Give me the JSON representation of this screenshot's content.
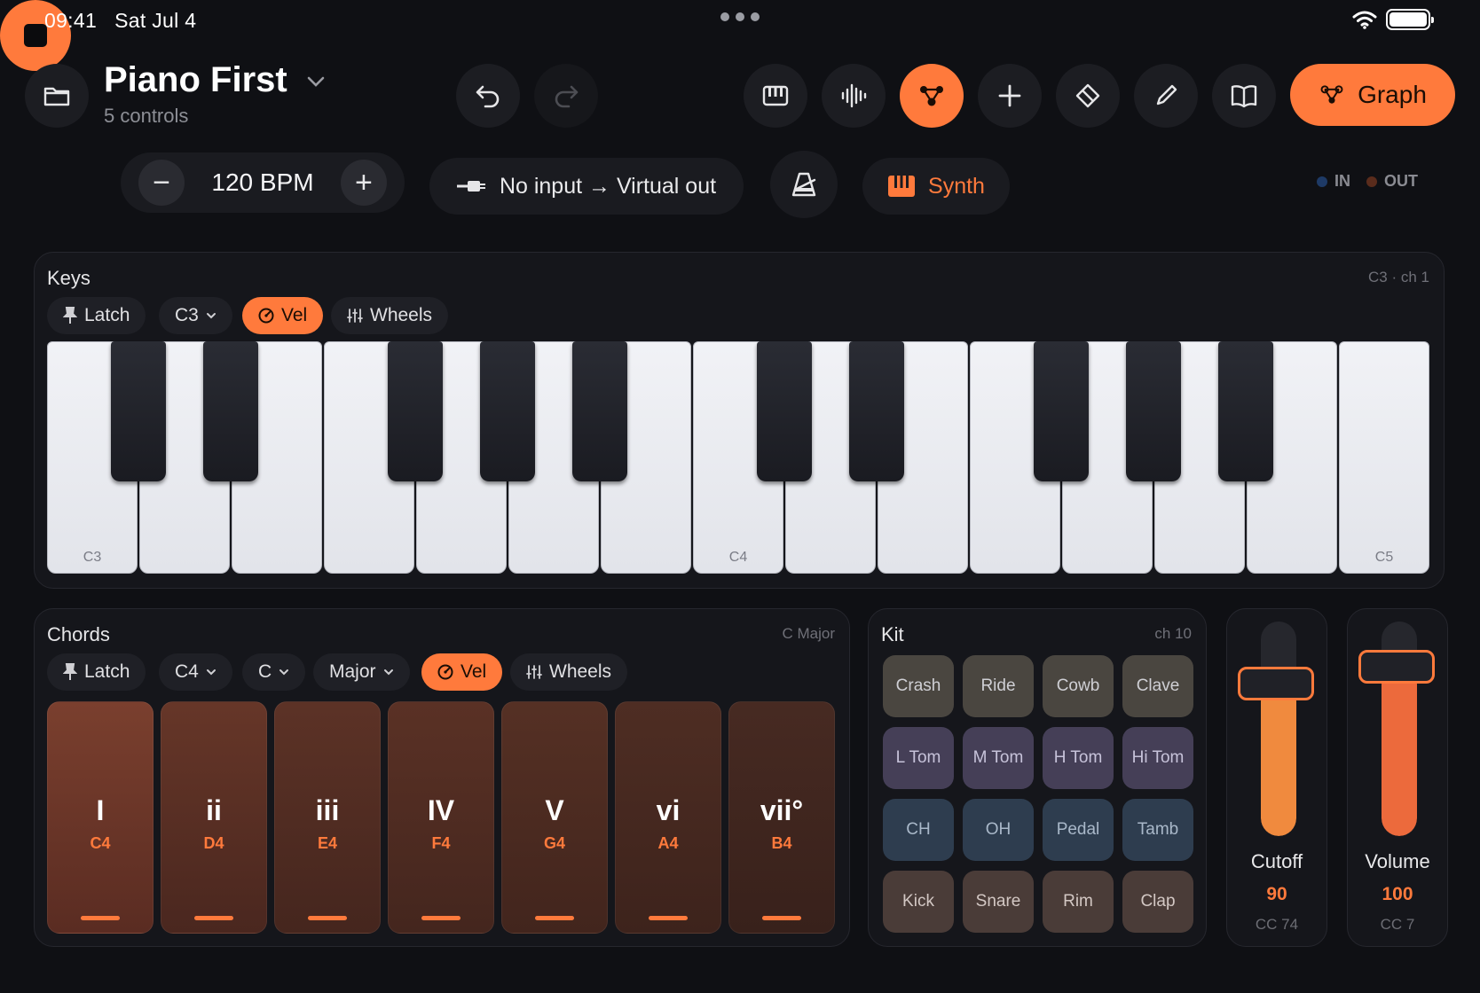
{
  "status": {
    "time": "09:41",
    "date": "Sat Jul 4"
  },
  "header": {
    "title": "Piano First",
    "subtitle": "5 controls",
    "graph_label": "Graph"
  },
  "transport": {
    "bpm": "120 BPM",
    "minus": "−",
    "plus": "+",
    "io_label": "No input → Virtual out",
    "synth_label": "Synth",
    "in_label": "IN",
    "out_label": "OUT"
  },
  "keys": {
    "title": "Keys",
    "meta": "C3 · ch 1",
    "latch": "Latch",
    "octave": "C3",
    "vel": "Vel",
    "wheels": "Wheels",
    "labels": {
      "c3": "C3",
      "c4": "C4",
      "c5": "C5"
    }
  },
  "chords": {
    "title": "Chords",
    "meta": "C Major",
    "latch": "Latch",
    "octave": "C4",
    "key": "C",
    "scale": "Major",
    "vel": "Vel",
    "wheels": "Wheels",
    "items": [
      {
        "num": "I",
        "note": "C4"
      },
      {
        "num": "ii",
        "note": "D4"
      },
      {
        "num": "iii",
        "note": "E4"
      },
      {
        "num": "IV",
        "note": "F4"
      },
      {
        "num": "V",
        "note": "G4"
      },
      {
        "num": "vi",
        "note": "A4"
      },
      {
        "num": "vii°",
        "note": "B4"
      }
    ]
  },
  "kit": {
    "title": "Kit",
    "meta": "ch 10",
    "pads": [
      "Crash",
      "Ride",
      "Cowb",
      "Clave",
      "L Tom",
      "M Tom",
      "H Tom",
      "Hi Tom",
      "CH",
      "OH",
      "Pedal",
      "Tamb",
      "Kick",
      "Snare",
      "Rim",
      "Clap"
    ]
  },
  "faders": [
    {
      "name": "Cutoff",
      "value": "90",
      "cc": "CC 74",
      "level": 0.71,
      "color": "#f08a3e"
    },
    {
      "name": "Volume",
      "value": "100",
      "cc": "CC 7",
      "level": 0.79,
      "color": "#ec6a3c"
    }
  ],
  "colors": {
    "accent": "#ff7a3c",
    "background": "#0f1014",
    "panel": "#15161b",
    "in_dot": "#1e3a66",
    "out_dot": "#5a2c1c"
  }
}
